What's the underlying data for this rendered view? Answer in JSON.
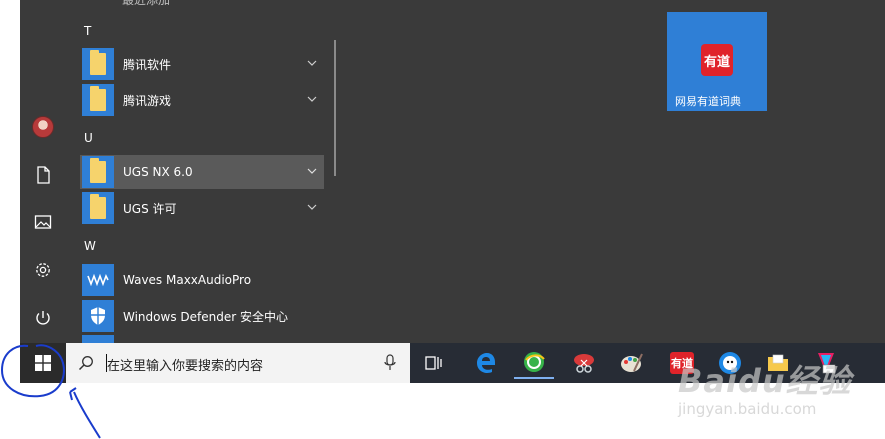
{
  "start_menu": {
    "partial_top_label": "最近添加",
    "sections": [
      {
        "letter": "T",
        "items": [
          {
            "label": "腾讯软件",
            "icon": "folder-icon",
            "expandable": true
          },
          {
            "label": "腾讯游戏",
            "icon": "folder-icon",
            "expandable": true
          }
        ]
      },
      {
        "letter": "U",
        "items": [
          {
            "label": "UGS NX 6.0",
            "icon": "folder-icon",
            "expandable": true,
            "hovered": true
          },
          {
            "label": "UGS 许可",
            "icon": "folder-icon",
            "expandable": true
          }
        ]
      },
      {
        "letter": "W",
        "items": [
          {
            "label": "Waves MaxxAudioPro",
            "icon": "waves-icon"
          },
          {
            "label": "Windows Defender 安全中心",
            "icon": "shield-icon"
          }
        ]
      }
    ],
    "tile": {
      "label": "网易有道词典",
      "logo_text": "有道"
    },
    "rail": [
      "avatar",
      "document-icon",
      "pictures-icon",
      "settings-icon",
      "power-icon"
    ]
  },
  "search": {
    "placeholder": "在这里输入你要搜索的内容"
  },
  "taskbar": {
    "apps": [
      "task-view-icon",
      "edge-icon",
      "360-browser-icon",
      "snipping-icon",
      "paint-icon",
      "youdao-icon",
      "qq-icon",
      "folder-icon",
      "app-icon"
    ],
    "youdao_text": "有道"
  },
  "watermark": {
    "main": "Baidu经验",
    "sub": "jingyan.baidu.com"
  },
  "colors": {
    "menu_bg": "#3a3a3a",
    "accent": "#2f7fd6",
    "taskbar_bg": "#272c35"
  }
}
